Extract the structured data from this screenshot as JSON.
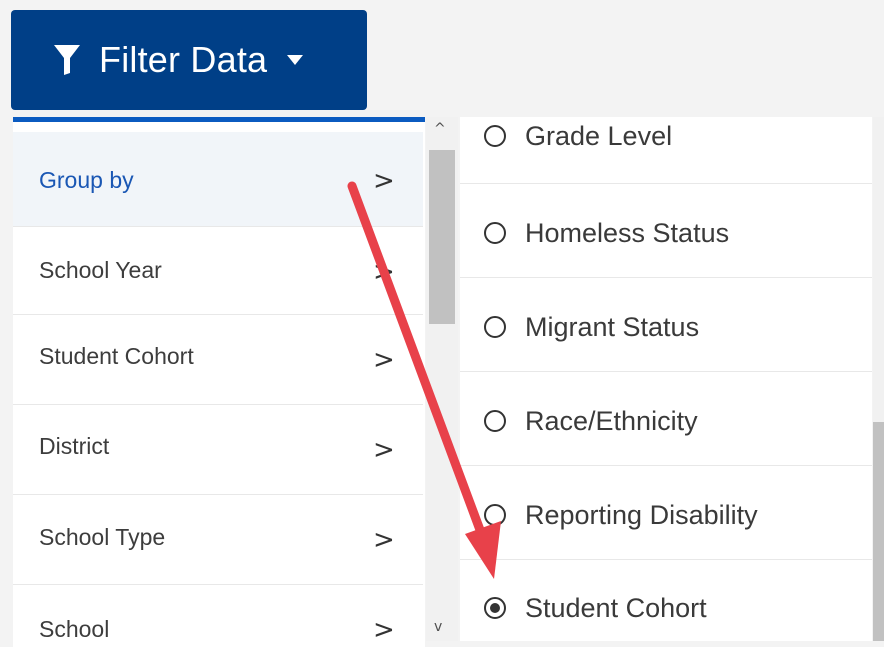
{
  "filter_button": {
    "label": "Filter Data",
    "icon": "funnel-icon",
    "caret_icon": "caret-down-icon"
  },
  "menu": {
    "items": [
      {
        "label": "Group by",
        "chevron": ">",
        "active": true
      },
      {
        "label": "School Year",
        "chevron": ">"
      },
      {
        "label": "Student Cohort",
        "chevron": ">"
      },
      {
        "label": "District",
        "chevron": ">"
      },
      {
        "label": "School Type",
        "chevron": ">"
      },
      {
        "label": "School",
        "chevron": ">"
      }
    ]
  },
  "scroll_up_glyph": "^",
  "scroll_down_glyph": "v",
  "group_by_options": [
    {
      "label": "Grade Level",
      "selected": false
    },
    {
      "label": "Homeless Status",
      "selected": false
    },
    {
      "label": "Migrant Status",
      "selected": false
    },
    {
      "label": "Race/Ethnicity",
      "selected": false
    },
    {
      "label": "Reporting Disability",
      "selected": false
    },
    {
      "label": "Student Cohort",
      "selected": true
    }
  ],
  "colors": {
    "button_bg": "#003f87",
    "menu_accent": "#0b5bc0",
    "active_text": "#1a57b4",
    "annotation_arrow": "#e8414a"
  }
}
